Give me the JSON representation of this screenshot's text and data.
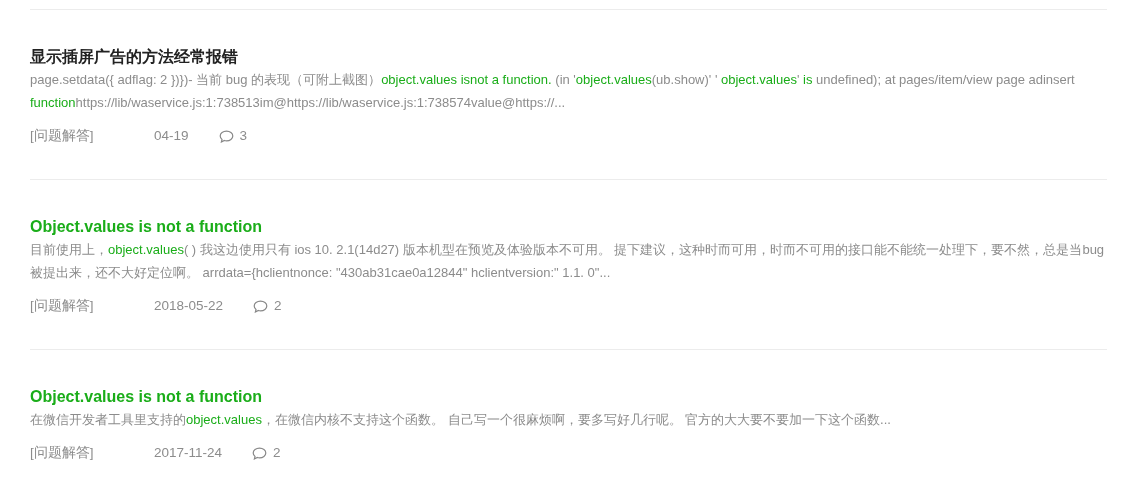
{
  "results": [
    {
      "title": "显示插屏广告的方法经常报错",
      "highlighted": false,
      "snippet": "page.setdata({ adflag: 2 })})- 当前 bug 的表现（可附上截图）**object.values isnot a function.** (in '**object.values**(ub.show)' ' **object.values**' **is** undefined); at pages/item/view page adinsert **function**https://lib/waservice.js:1:738513im@https://lib/waservice.js:1:738574value@https://...",
      "category": "[问题解答]",
      "date": "04-19",
      "comments": "3"
    },
    {
      "title": "Object.values is not a function",
      "highlighted": true,
      "snippet": "目前使用上，**object.values**( ) 我这边使用只有 ios 10. 2.1(14d27) 版本机型在预览及体验版本不可用。 提下建议，这种时而可用，时而不可用的接口能不能统一处理下，要不然，总是当bug被提出来，还不大好定位啊。 arrdata={hclientnonce: \"430ab31cae0a12844\" hclientversion:\" 1.1. 0\"...",
      "category": "[问题解答]",
      "date": "2018-05-22",
      "comments": "2"
    },
    {
      "title": "Object.values is not a function",
      "highlighted": true,
      "snippet": "在微信开发者工具里支持的**object.values**，在微信内核不支持这个函数。 自己写一个很麻烦啊，要多写好几行呢。 官方的大大要不要加一下这个函数...",
      "category": "[问题解答]",
      "date": "2017-11-24",
      "comments": "2"
    }
  ]
}
